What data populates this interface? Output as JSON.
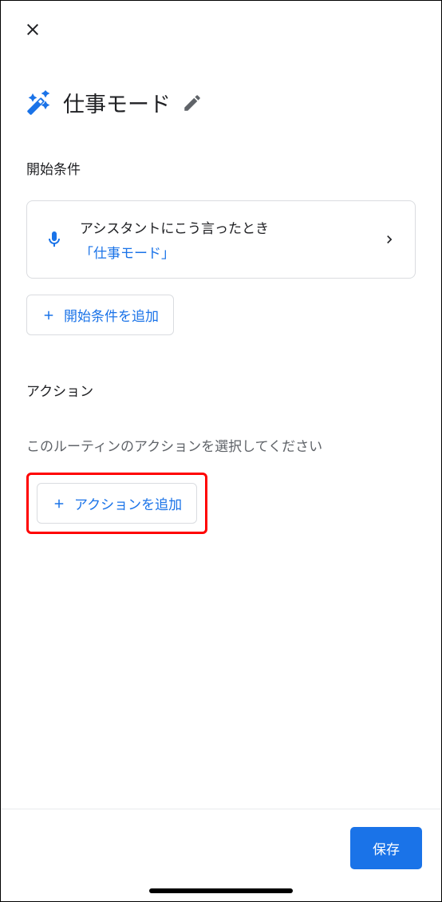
{
  "title": "仕事モード",
  "sections": {
    "starters": {
      "heading": "開始条件",
      "card": {
        "title": "アシスタントにこう言ったとき",
        "phrase": "「仕事モード」"
      },
      "add_label": "開始条件を追加"
    },
    "actions": {
      "heading": "アクション",
      "description": "このルーティンのアクションを選択してください",
      "add_label": "アクションを追加"
    }
  },
  "footer": {
    "save_label": "保存"
  }
}
